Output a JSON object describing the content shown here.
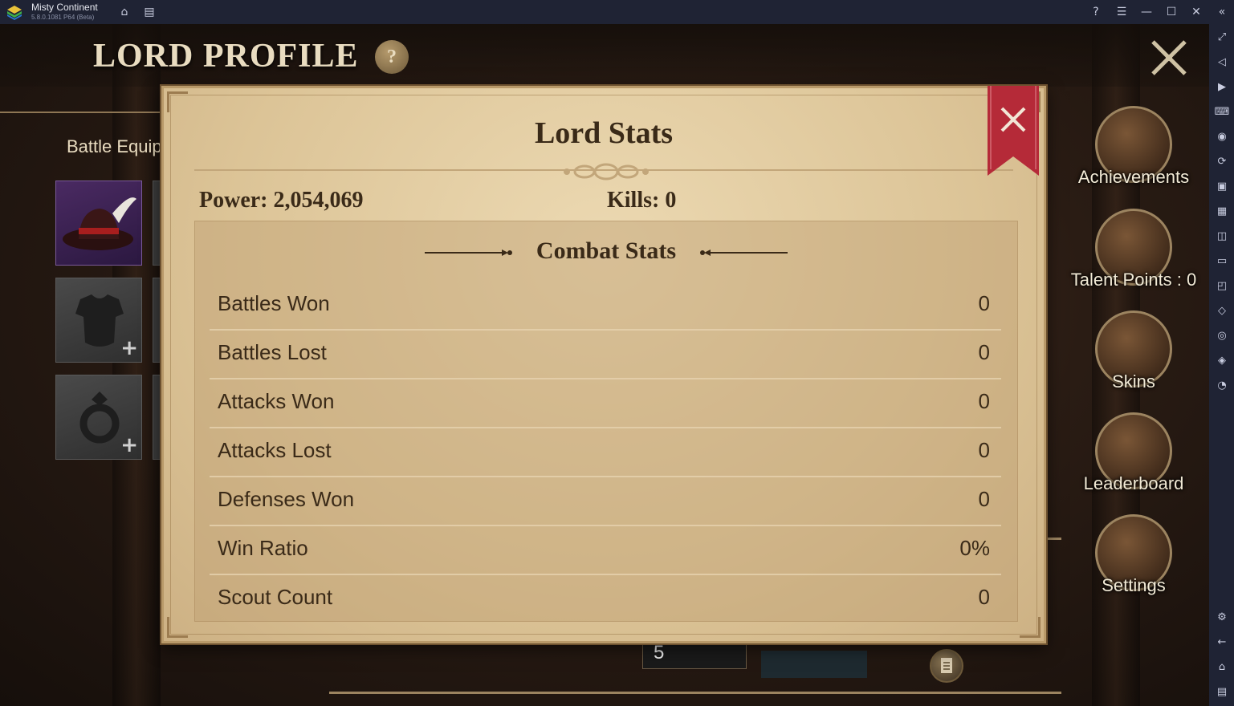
{
  "titlebar": {
    "app_name": "Misty Continent",
    "app_version": "5.8.0.1081 P64 (Beta)",
    "icons": [
      "home-icon",
      "multi-instance-icon",
      "help-icon",
      "menu-icon",
      "minimize-icon",
      "maximize-icon",
      "close-icon",
      "collapse-sidebar-icon"
    ]
  },
  "sidebar": {
    "icons": [
      "fullscreen-icon",
      "volume-icon",
      "screen-record-icon",
      "keyboard-icon",
      "macro-icon",
      "sync-icon",
      "install-apk-icon",
      "fps-icon",
      "screenshot-icon",
      "folder-icon",
      "resize-icon",
      "eco-mode-icon",
      "location-icon",
      "layers-icon",
      "clock-icon",
      "settings-icon",
      "back-icon",
      "home-icon",
      "recent-apps-icon"
    ]
  },
  "game": {
    "page_title": "LORD PROFILE",
    "help_label": "?",
    "battle_equip_label": "Battle Equip",
    "level": "5",
    "menu": [
      {
        "label": "Achievements",
        "icon": "achievements-medal-icon"
      },
      {
        "label": "Talent Points : 0",
        "icon": "talent-book-icon"
      },
      {
        "label": "Skins",
        "icon": "skins-castle-icon"
      },
      {
        "label": "Leaderboard",
        "icon": "leaderboard-trophy-icon"
      },
      {
        "label": "Settings",
        "icon": "settings-gear-icon"
      }
    ]
  },
  "modal": {
    "title": "Lord Stats",
    "power": "Power: 2,054,069",
    "kills": "Kills: 0",
    "combat_title": "Combat Stats",
    "stats": [
      {
        "label": "Battles Won",
        "value": "0"
      },
      {
        "label": "Battles Lost",
        "value": "0"
      },
      {
        "label": "Attacks Won",
        "value": "0"
      },
      {
        "label": "Attacks Lost",
        "value": "0"
      },
      {
        "label": "Defenses Won",
        "value": "0"
      },
      {
        "label": "Win Ratio",
        "value": "0%"
      },
      {
        "label": "Scout Count",
        "value": "0"
      }
    ]
  },
  "colors": {
    "titlebar_bg": "#1f2334",
    "parchment": "#dfc89c",
    "text_dark": "#3a2a18",
    "ribbon_red": "#b52a38",
    "gold": "#9c8460"
  }
}
